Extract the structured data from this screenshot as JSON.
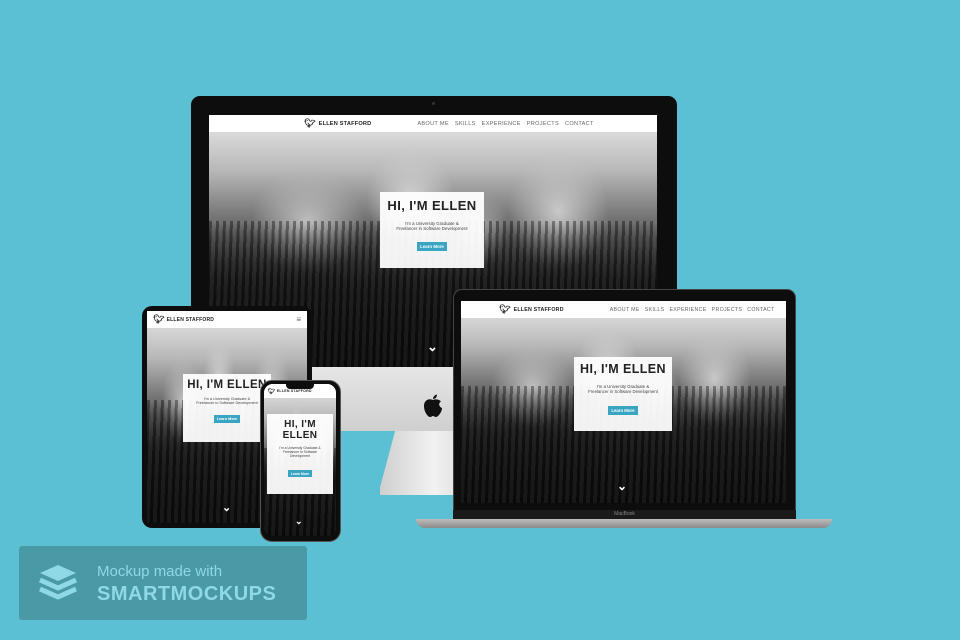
{
  "site": {
    "brand_name": "ELLEN STAFFORD",
    "nav": [
      "ABOUT ME",
      "SKILLS",
      "EXPERIENCE",
      "PROJECTS",
      "CONTACT"
    ],
    "hero_title": "HI, I'M ELLEN",
    "hero_title_phone_line1": "HI, I'M",
    "hero_title_phone_line2": "ELLEN",
    "hero_sub_line1": "I'm a University Graduate &",
    "hero_sub_line2": "Freelancer in Software Development",
    "hero_sub_phone_line1": "I'm a University Graduate &",
    "hero_sub_phone_line2": "Freelancer in Software",
    "hero_sub_phone_line3": "Development",
    "cta_label": "Learn More",
    "chevron_glyph": "⌄",
    "menu_glyph": "≡"
  },
  "laptop": {
    "model_label": "MacBook"
  },
  "apple_logo": "",
  "watermark": {
    "line1": "Mockup made with",
    "line2": "SMARTMOCKUPS"
  },
  "colors": {
    "background": "#5bc0d3",
    "cta": "#3aa5c3",
    "navbar": "#ffffff"
  }
}
